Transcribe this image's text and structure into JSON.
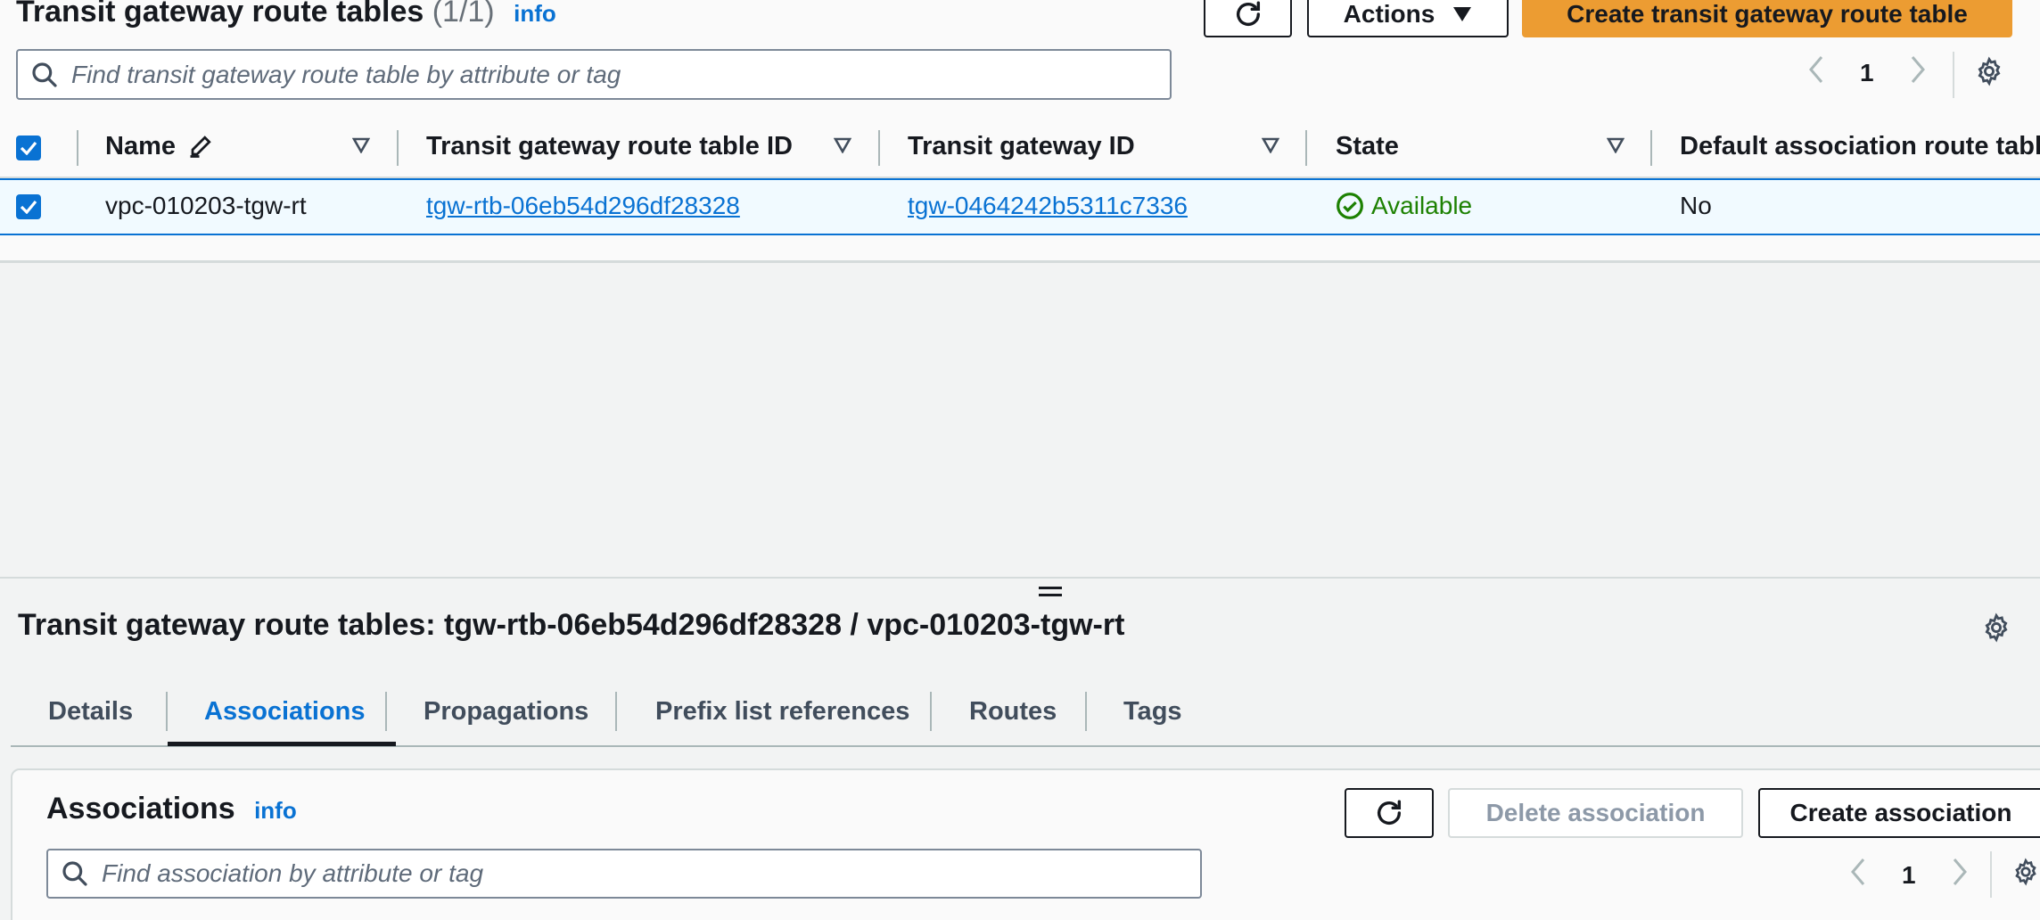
{
  "route_tables": {
    "title": "Transit gateway route tables",
    "count": "(1/1)",
    "info_label": "info",
    "actions_label": "Actions",
    "create_label": "Create transit gateway route table",
    "search_placeholder": "Find transit gateway route table by attribute or tag",
    "page_number": "1",
    "columns": [
      "Name",
      "Transit gateway route table ID",
      "Transit gateway ID",
      "State",
      "Default association route table"
    ],
    "rows": [
      {
        "name": "vpc-010203-tgw-rt",
        "route_table_id": "tgw-rtb-06eb54d296df28328",
        "gateway_id": "tgw-0464242b5311c7336",
        "state": "Available",
        "default_association": "No",
        "selected": true
      }
    ]
  },
  "detail": {
    "title": "Transit gateway route tables: tgw-rtb-06eb54d296df28328 / vpc-010203-tgw-rt",
    "tabs": [
      "Details",
      "Associations",
      "Propagations",
      "Prefix list references",
      "Routes",
      "Tags"
    ],
    "active_tab": "Associations"
  },
  "associations": {
    "title": "Associations",
    "info_label": "info",
    "delete_label": "Delete association",
    "create_label": "Create association",
    "search_placeholder": "Find association by attribute or tag",
    "page_number": "1"
  },
  "colors": {
    "primary_button": "#ec9c32",
    "link": "#0972d3",
    "status_available": "#1d8102"
  }
}
